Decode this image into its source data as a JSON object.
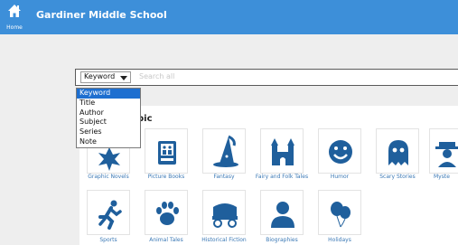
{
  "header": {
    "home_label": "Home",
    "school_name": "Gardiner Middle School",
    "bg_color": "#3d8fd9"
  },
  "search": {
    "selected_field": "Keyword",
    "placeholder": "Search all"
  },
  "dropdown": {
    "options": [
      "Keyword",
      "Title",
      "Author",
      "Subject",
      "Series",
      "Note"
    ],
    "highlighted": "Keyword",
    "highlight_color": "#1e6fd0"
  },
  "browse": {
    "heading_visible_fragment": "pic",
    "tiles": [
      {
        "label": "Graphic Novels",
        "icon": "graphic-novel-icon"
      },
      {
        "label": "Picture Books",
        "icon": "picture-book-icon"
      },
      {
        "label": "Fantasy",
        "icon": "wizard-hat-icon"
      },
      {
        "label": "Fairy and Folk Tales",
        "icon": "castle-icon"
      },
      {
        "label": "Humor",
        "icon": "smiley-icon"
      },
      {
        "label": "Scary Stories",
        "icon": "ghost-icon"
      },
      {
        "label": "Myste",
        "icon": "detective-icon"
      },
      {
        "label": "Sports",
        "icon": "runner-icon"
      },
      {
        "label": "Animal Tales",
        "icon": "paw-icon"
      },
      {
        "label": "Historical Fiction",
        "icon": "covered-wagon-icon"
      },
      {
        "label": "Biographies",
        "icon": "person-icon"
      },
      {
        "label": "Holidays",
        "icon": "balloons-icon"
      }
    ],
    "icon_color": "#1f5f9c",
    "caption_color": "#3a78b5"
  }
}
